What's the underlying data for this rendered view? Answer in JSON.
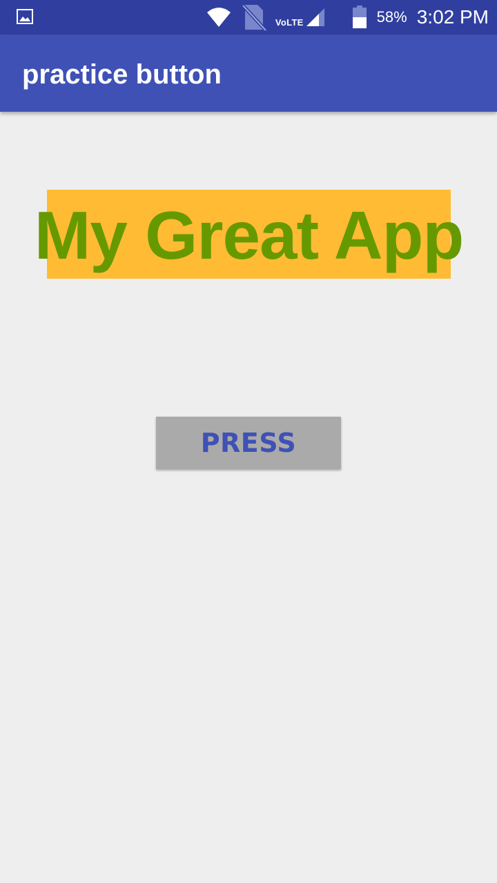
{
  "status_bar": {
    "notification_icon": "image-icon",
    "network_label": "VoLTE",
    "battery_percent": "58%",
    "battery_level": 0.58,
    "time": "3:02 PM"
  },
  "app_bar": {
    "title": "practice button"
  },
  "main": {
    "headline": "My Great App",
    "button_label": "PRESS"
  },
  "colors": {
    "status_bar": "#303f9f",
    "primary": "#3f51b5",
    "background": "#eeeeee",
    "headline_bg": "#ffbb33",
    "headline_text": "#669900",
    "button_bg": "#aaaaaa",
    "button_text": "#3f51b5"
  }
}
